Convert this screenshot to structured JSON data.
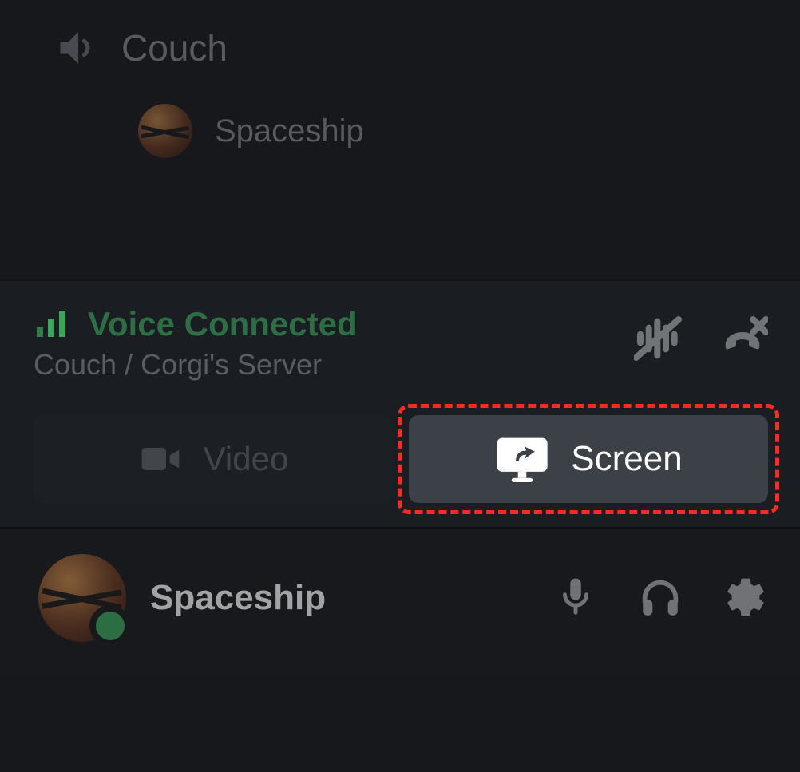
{
  "channel": {
    "name": "Couch",
    "member_name": "Spaceship"
  },
  "voice_status": {
    "label": "Voice Connected",
    "location": "Couch / Corgi's Server"
  },
  "actions": {
    "video_label": "Video",
    "screen_label": "Screen"
  },
  "user": {
    "name": "Spaceship",
    "status": "online"
  },
  "icons": {
    "speaker": "speaker-icon",
    "signal": "signal-icon",
    "noise_suppress": "noise-suppression-icon",
    "disconnect": "disconnect-icon",
    "video": "video-camera-icon",
    "screen": "screen-share-icon",
    "mic": "microphone-icon",
    "headphones": "headphones-icon",
    "settings": "gear-icon"
  },
  "colors": {
    "accent_green": "#3ba55c",
    "highlight_red": "#ff2a1f",
    "bg_dark": "#16181c",
    "btn_gray": "#3c4047"
  }
}
